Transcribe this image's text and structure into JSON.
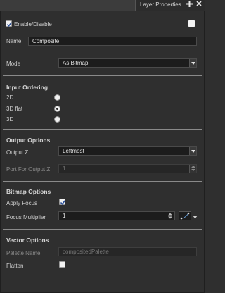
{
  "tab": {
    "title": "Layer Properties",
    "pin_icon": "pin-icon",
    "close_icon": "close-icon"
  },
  "enable": {
    "label": "Enable/Disable",
    "checked": true,
    "swatch_checked": false
  },
  "name": {
    "label": "Name:",
    "value": "Composite"
  },
  "mode": {
    "label": "Mode",
    "value": "As Bitmap"
  },
  "input_ordering": {
    "heading": "Input Ordering",
    "options": [
      {
        "label": "2D",
        "selected": false
      },
      {
        "label": "3D flat",
        "selected": true
      },
      {
        "label": "3D",
        "selected": false
      }
    ]
  },
  "output_options": {
    "heading": "Output Options",
    "output_z_label": "Output Z",
    "output_z_value": "Leftmost",
    "port_label": "Port For Output Z",
    "port_value": "1"
  },
  "bitmap_options": {
    "heading": "Bitmap Options",
    "apply_focus_label": "Apply Focus",
    "apply_focus_checked": true,
    "focus_multiplier_label": "Focus Multiplier",
    "focus_multiplier_value": "1",
    "function_icon": "function-curve-icon"
  },
  "vector_options": {
    "heading": "Vector Options",
    "palette_name_label": "Palette Name",
    "palette_name_placeholder": "compositedPalette",
    "flatten_label": "Flatten",
    "flatten_checked": false
  }
}
